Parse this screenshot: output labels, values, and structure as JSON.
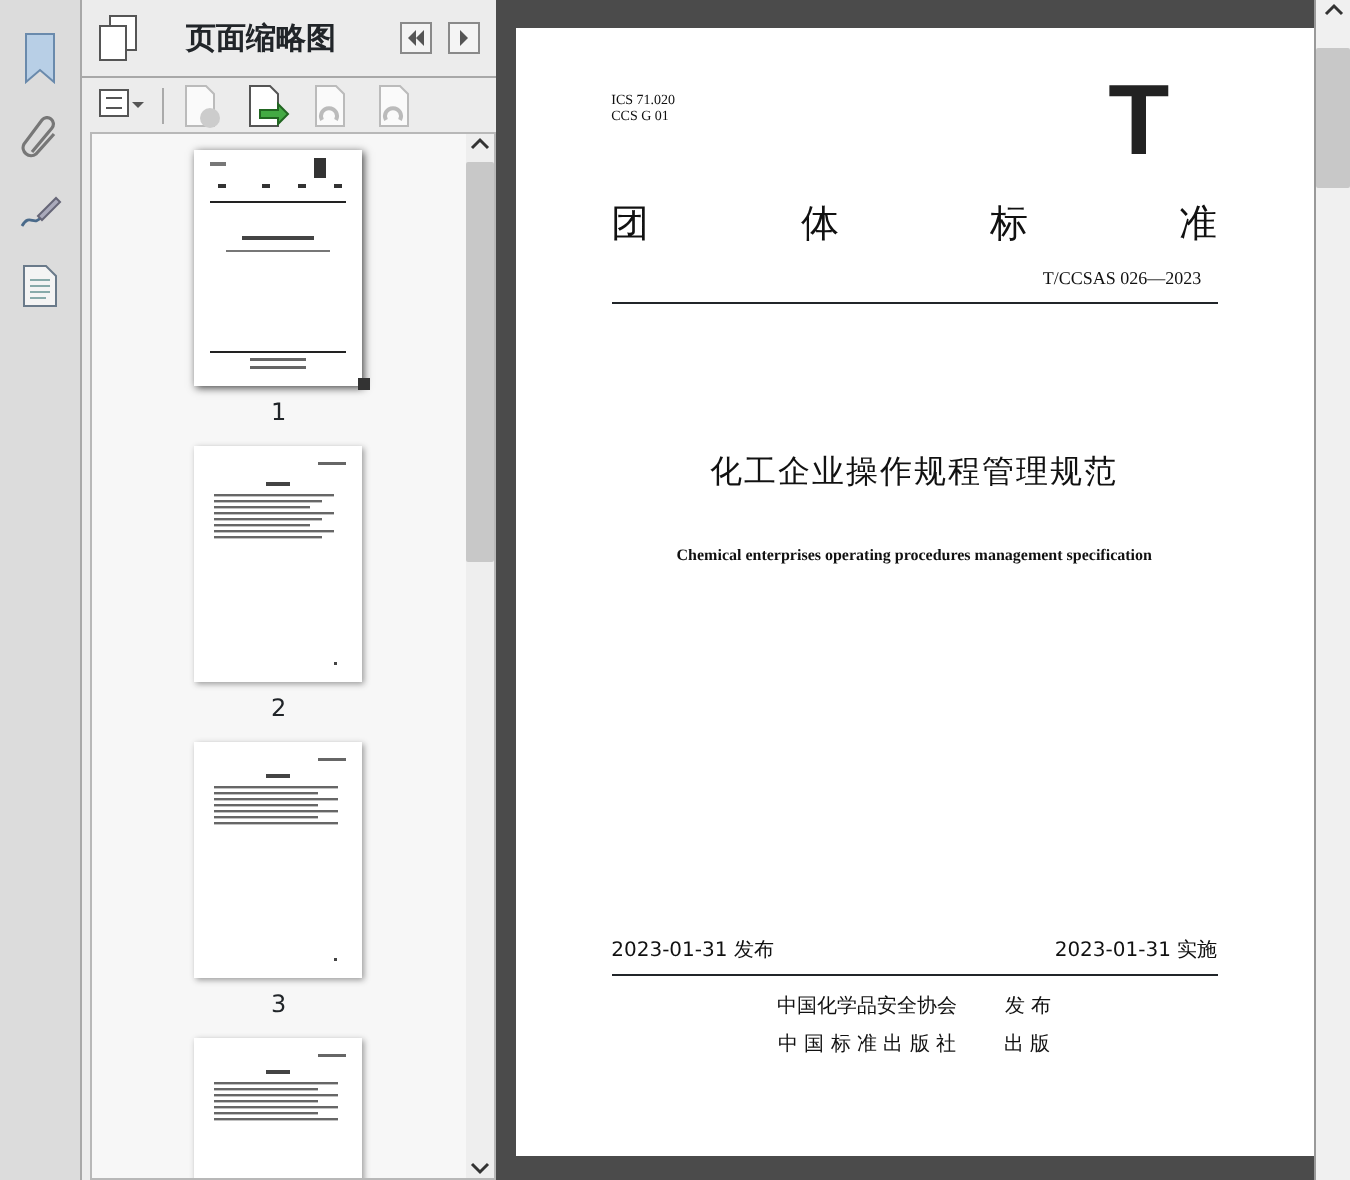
{
  "panel": {
    "title": "页面缩略图"
  },
  "toolbar": [
    {
      "kind": "options",
      "disabled": false
    },
    {
      "kind": "delete",
      "disabled": true
    },
    {
      "kind": "insert",
      "disabled": false
    },
    {
      "kind": "rotate",
      "disabled": true
    },
    {
      "kind": "rotate",
      "disabled": true
    }
  ],
  "thumbnails": [
    {
      "label": "1",
      "kind": "cover",
      "selected": true
    },
    {
      "label": "2",
      "kind": "toc",
      "selected": false
    },
    {
      "label": "3",
      "kind": "text",
      "selected": false
    },
    {
      "kind": "text",
      "selected": false
    }
  ],
  "document": {
    "ics": "ICS 71.020",
    "ccs": "CCS G 01",
    "logo": "T",
    "heading": [
      "团",
      "体",
      "标",
      "准"
    ],
    "code": "T/CCSAS 026—2023",
    "title": "化工企业操作规程管理规范",
    "subtitle": "Chemical enterprises operating procedures management specification",
    "issued": "2023-01-31 发布",
    "effective": "2023-01-31 实施",
    "publishers": [
      {
        "name": "中国化学品安全协会",
        "action": "发 布"
      },
      {
        "name": "中 国 标 准 出 版 社",
        "action": "出 版"
      }
    ]
  }
}
